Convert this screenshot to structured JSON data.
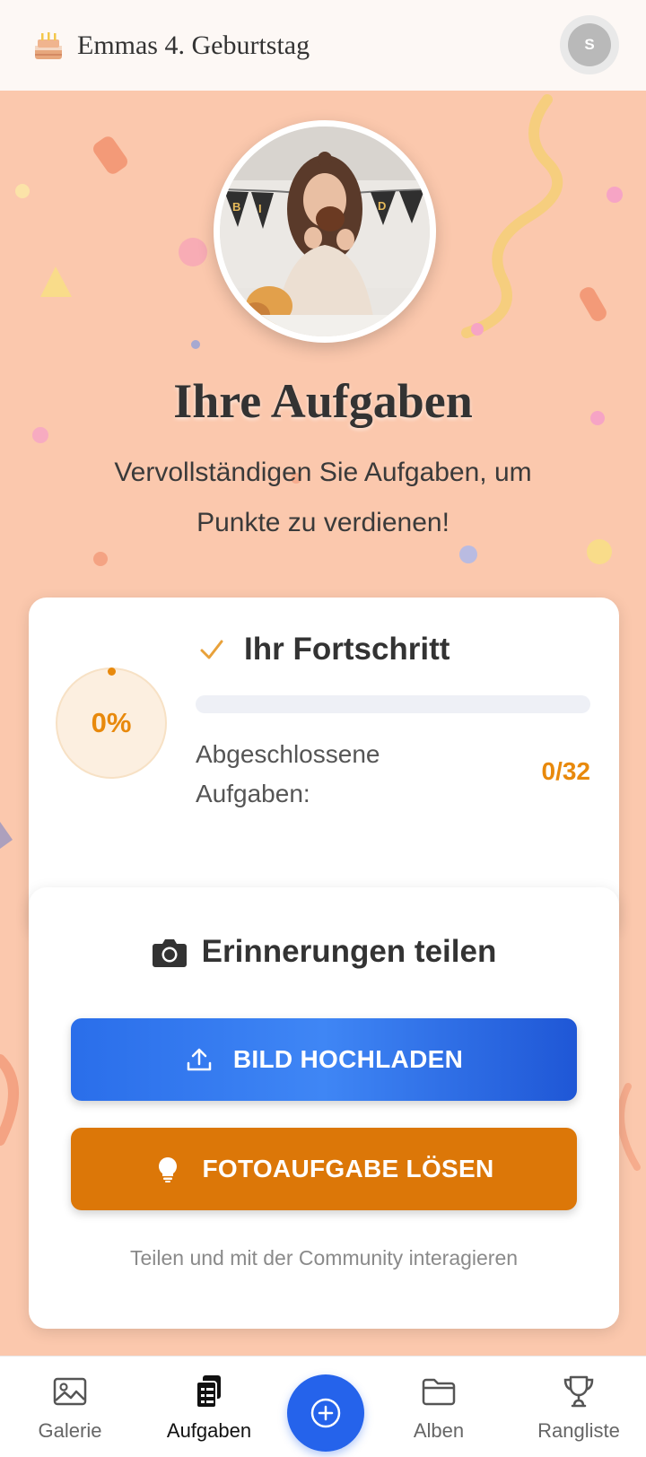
{
  "header": {
    "title": "Emmas 4. Geburtstag",
    "avatar_initial": "S"
  },
  "main": {
    "title": "Ihre Aufgaben",
    "subtitle": "Vervollständigen Sie Aufgaben, um Punkte zu verdienen!"
  },
  "progress": {
    "percent_text": "0%",
    "progress_fraction": 0,
    "title": "Ihr Fortschritt",
    "completed_label": "Abgeschlossene Aufgaben:",
    "completed_count": "0/32"
  },
  "share": {
    "title": "Erinnerungen teilen",
    "upload_label": "BILD HOCHLADEN",
    "task_label": "FOTOAUFGABE LÖSEN",
    "footer": "Teilen und mit der Community interagieren"
  },
  "nav": {
    "items": [
      {
        "label": "Galerie",
        "icon": "image-icon"
      },
      {
        "label": "Aufgaben",
        "icon": "tasks-icon"
      },
      {
        "label": "Alben",
        "icon": "folder-icon"
      },
      {
        "label": "Rangliste",
        "icon": "trophy-icon"
      }
    ],
    "active": "Aufgaben"
  },
  "colors": {
    "background": "#fbc8ad",
    "accent_orange": "#e8890c",
    "primary_blue": "#2563eb",
    "task_button": "#dc7708"
  }
}
